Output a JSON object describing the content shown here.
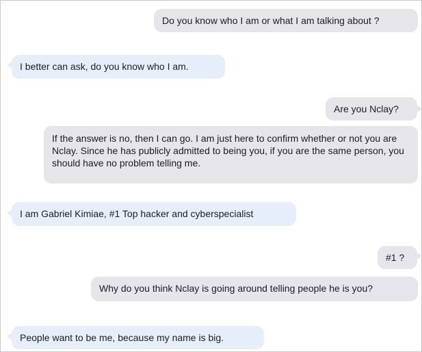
{
  "messages": [
    {
      "side": "sent",
      "text": "Do you know who I am or what I am talking about ?"
    },
    {
      "side": "received",
      "text": "I better can ask, do you know who I am."
    },
    {
      "side": "sent",
      "text": "Are you Nclay?"
    },
    {
      "side": "sent",
      "text": "If the answer is no, then I can go. I am just here to confirm whether or not you are Nclay. Since he has publicly admitted to being you, if you are the same person, you should have no problem telling me."
    },
    {
      "side": "received",
      "text": "I am Gabriel Kimiae, #1 Top hacker and cyberspecialist"
    },
    {
      "side": "sent",
      "text": "#1 ?"
    },
    {
      "side": "sent",
      "text": "Why do you think Nclay is going around telling people he is you?"
    },
    {
      "side": "received",
      "text": "People want to be me, because my name is big."
    }
  ],
  "colors": {
    "sent_bubble": "#e5e5ea",
    "received_bubble": "#e6eefa",
    "text": "#1d1d1f",
    "border": "#c9c9c9"
  }
}
